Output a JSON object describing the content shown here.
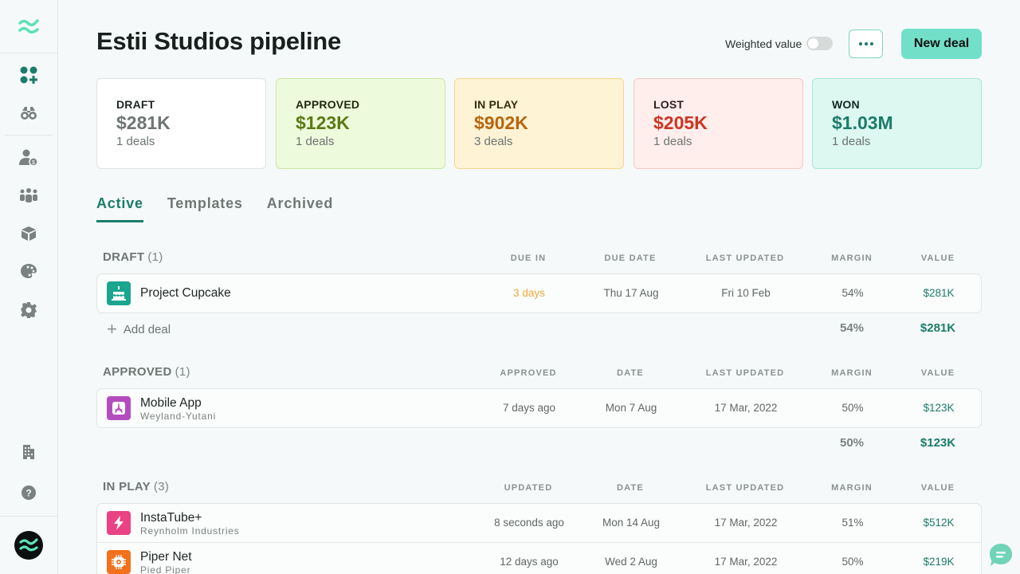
{
  "sidebar": {
    "logo": "wave-logo",
    "items": [
      {
        "name": "dashboard",
        "icon": "apps-add-icon",
        "active": true
      },
      {
        "name": "explore",
        "icon": "binoculars-icon",
        "active": false
      },
      {
        "name": "clients",
        "icon": "user-dollar-icon",
        "active": false
      },
      {
        "name": "team",
        "icon": "people-group-icon",
        "active": false
      },
      {
        "name": "products",
        "icon": "cube-icon",
        "active": false
      },
      {
        "name": "branding",
        "icon": "palette-icon",
        "active": false
      },
      {
        "name": "settings",
        "icon": "gear-icon",
        "active": false
      },
      {
        "name": "company",
        "icon": "building-icon",
        "active": false
      },
      {
        "name": "help",
        "icon": "question-icon",
        "active": false
      }
    ]
  },
  "header": {
    "title": "Estii Studios pipeline",
    "weighted_label": "Weighted value",
    "weighted_on": false,
    "new_deal_label": "New deal"
  },
  "summary": [
    {
      "label": "DRAFT",
      "amount": "$281K",
      "count": "1 deals",
      "bg": "#ffffff",
      "border": "#dfe3e2",
      "label_color": "#1f2624",
      "amount_color": "#6e7573"
    },
    {
      "label": "APPROVED",
      "amount": "$123K",
      "count": "1 deals",
      "bg": "#eefadc",
      "border": "#c9e8a4",
      "label_color": "#1f2a10",
      "amount_color": "#5a7a14"
    },
    {
      "label": "IN PLAY",
      "amount": "$902K",
      "count": "3 deals",
      "bg": "#fff3d6",
      "border": "#f5d68e",
      "label_color": "#3a2a10",
      "amount_color": "#b8650c"
    },
    {
      "label": "LOST",
      "amount": "$205K",
      "count": "1 deals",
      "bg": "#ffeeec",
      "border": "#f6c9c4",
      "label_color": "#2e1d1b",
      "amount_color": "#cc3522"
    },
    {
      "label": "WON",
      "amount": "$1.03M",
      "count": "1 deals",
      "bg": "#ddf8f0",
      "border": "#a8e6d4",
      "label_color": "#0f2a24",
      "amount_color": "#1b7c6b"
    }
  ],
  "tabs": [
    {
      "label": "Active",
      "active": true
    },
    {
      "label": "Templates",
      "active": false
    },
    {
      "label": "Archived",
      "active": false
    }
  ],
  "sections": [
    {
      "title": "DRAFT",
      "count": "(1)",
      "columns": [
        "DUE IN",
        "DUE DATE",
        "LAST UPDATED",
        "MARGIN",
        "VALUE"
      ],
      "rows": [
        {
          "name": "Project Cupcake",
          "client": "",
          "icon": "cake-icon",
          "icon_bg": "#1aa58f",
          "c1": "3 days",
          "c2": "Thu 17 Aug",
          "c3": "Fri 10 Feb",
          "margin": "54%",
          "value": "$281K"
        }
      ],
      "add_label": "Add deal",
      "total_margin": "54%",
      "total_value": "$281K"
    },
    {
      "title": "APPROVED",
      "count": "(1)",
      "columns": [
        "APPROVED",
        "DATE",
        "LAST UPDATED",
        "MARGIN",
        "VALUE"
      ],
      "rows": [
        {
          "name": "Mobile App",
          "client": "Weyland-Yutani",
          "icon": "app-store-icon",
          "icon_bg": "#b44cc0",
          "c1": "7 days ago",
          "c2": "Mon 7 Aug",
          "c3": "17 Mar, 2022",
          "margin": "50%",
          "value": "$123K"
        }
      ],
      "total_margin": "50%",
      "total_value": "$123K"
    },
    {
      "title": "IN PLAY",
      "count": "(3)",
      "columns": [
        "UPDATED",
        "DATE",
        "LAST UPDATED",
        "MARGIN",
        "VALUE"
      ],
      "rows": [
        {
          "name": "InstaTube+",
          "client": "Reynholm Industries",
          "icon": "lightning-icon",
          "icon_bg": "#ea4285",
          "c1": "8 seconds ago",
          "c2": "Mon 14 Aug",
          "c3": "17 Mar, 2022",
          "margin": "51%",
          "value": "$512K"
        },
        {
          "name": "Piper Net",
          "client": "Pied Piper",
          "icon": "chip-icon",
          "icon_bg": "#f2711c",
          "c1": "12 days ago",
          "c2": "Wed 2 Aug",
          "c3": "17 Mar, 2022",
          "margin": "50%",
          "value": "$219K"
        }
      ]
    }
  ],
  "chat": {
    "icon": "chat-icon"
  }
}
